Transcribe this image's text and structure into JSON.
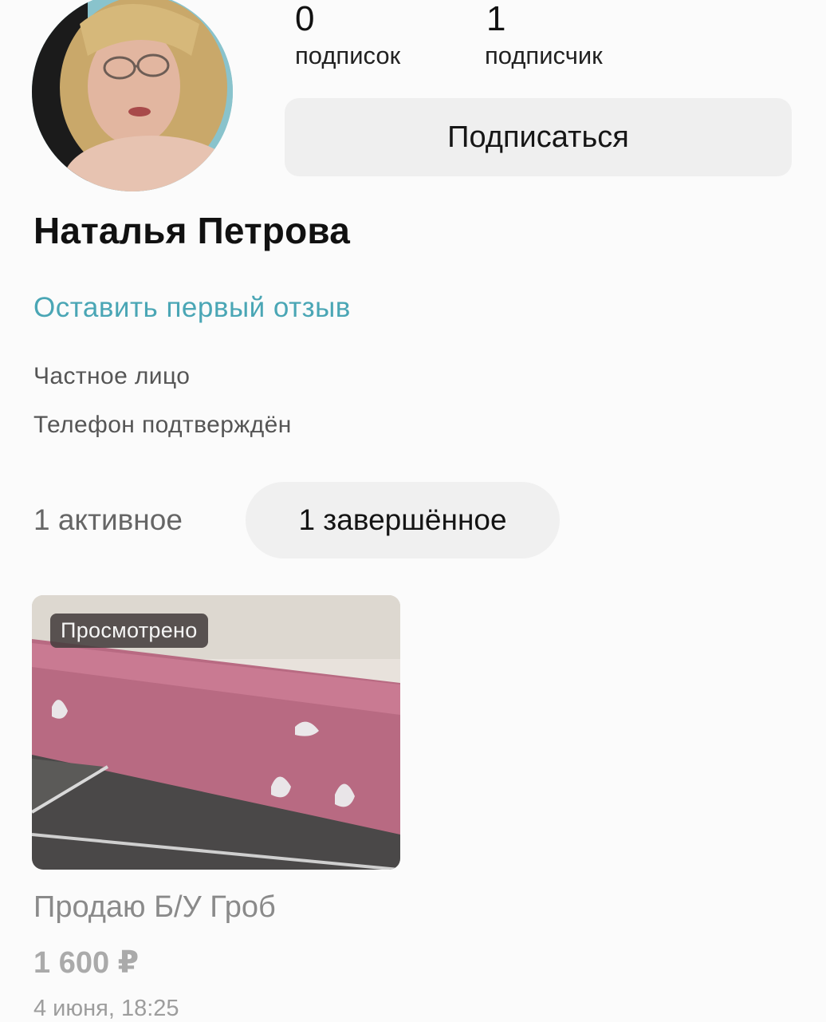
{
  "profile": {
    "name": "Наталья Петрова",
    "stats": {
      "subscriptions_count": "0",
      "subscriptions_label": "подписок",
      "followers_count": "1",
      "followers_label": "подписчик"
    },
    "subscribe_label": "Подписаться",
    "review_link": "Оставить первый отзыв",
    "seller_type": "Частное лицо",
    "phone_status": "Телефон подтверждён"
  },
  "tabs": [
    {
      "label": "1 активное",
      "selected": false
    },
    {
      "label": "1 завершённое",
      "selected": true
    }
  ],
  "listing": {
    "badge": "Просмотрено",
    "title": "Продаю Б/У Гроб",
    "price": "1 600 ₽",
    "date": "4 июня, 18:25"
  },
  "colors": {
    "accent_link": "#4aa6b5",
    "button_bg": "#efefef",
    "page_bg": "#fbfbfb"
  }
}
